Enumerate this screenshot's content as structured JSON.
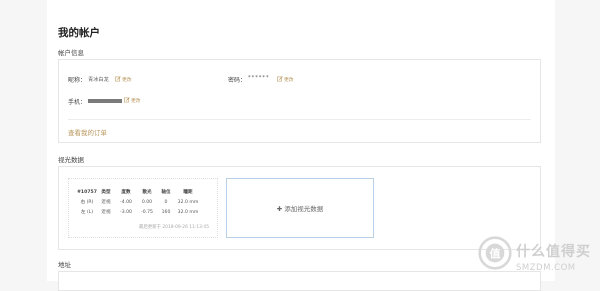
{
  "page": {
    "title": "我的帐户"
  },
  "account": {
    "section_label": "帐户信息",
    "nickname": {
      "label": "昵称：",
      "value": "青冰白龙",
      "edit": "更改"
    },
    "password": {
      "label": "密码：",
      "value": "******",
      "edit": "更改"
    },
    "phone": {
      "label": "手机：",
      "edit": "更改"
    },
    "orders_link": "查看我的订单"
  },
  "vision": {
    "section_label": "视光数据",
    "record": {
      "id": "#10757",
      "headers": [
        "类型",
        "度数",
        "散光",
        "轴位",
        "瞳距"
      ],
      "rows": [
        {
          "eye": "右 (R)",
          "type": "近视",
          "sph": "-4.00",
          "cyl": "0.00",
          "axis": "0",
          "pd": "32.0 mm"
        },
        {
          "eye": "左 (L)",
          "type": "近视",
          "sph": "-3.00",
          "cyl": "-0.75",
          "axis": "160",
          "pd": "32.0 mm"
        }
      ],
      "updated": "最后更新于 2018-09-26 11:13:45"
    },
    "add_button": {
      "icon": "plus-icon",
      "label": "添加视光数据"
    }
  },
  "address": {
    "section_label": "地址"
  },
  "watermark": {
    "cn": "什么值得买",
    "en": "SMZDM.COM"
  },
  "colors": {
    "accent": "#b8955a",
    "add_border": "#b9cfe8"
  }
}
